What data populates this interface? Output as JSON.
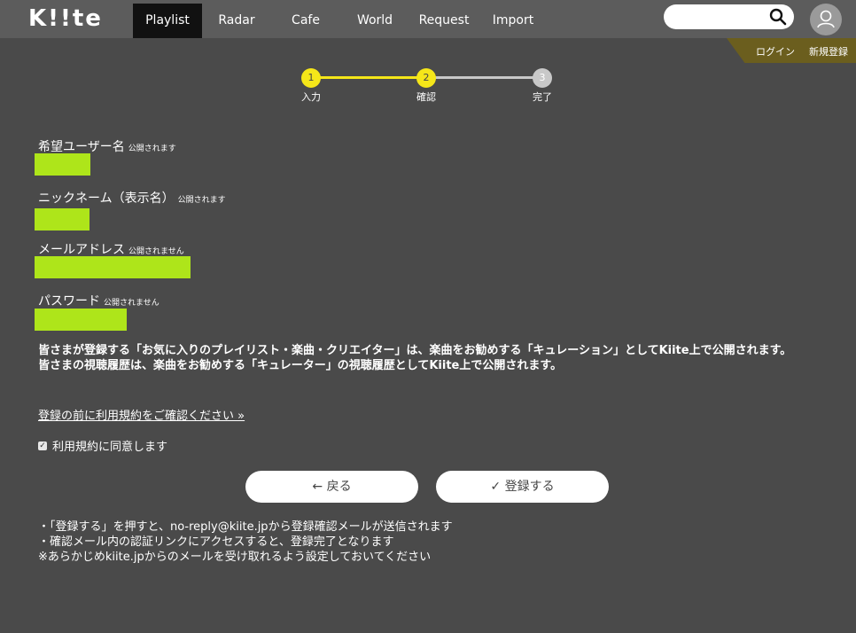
{
  "header": {
    "logo": "K!!te",
    "nav": [
      "Playlist",
      "Radar",
      "Cafe",
      "World",
      "Request",
      "Import"
    ],
    "active_nav": "Playlist",
    "search": {
      "placeholder": ""
    },
    "login": "ログイン",
    "register": "新規登録"
  },
  "steps": [
    {
      "num": "1",
      "label": "入力",
      "state": "done"
    },
    {
      "num": "2",
      "label": "確認",
      "state": "current"
    },
    {
      "num": "3",
      "label": "完了",
      "state": "pending"
    }
  ],
  "fields": [
    {
      "label": "希望ユーザー名",
      "note": "公開されます"
    },
    {
      "label": "ニックネーム（表示名）",
      "note": "公開されます"
    },
    {
      "label": "メールアドレス",
      "note": "公開されません"
    },
    {
      "label": "パスワード",
      "note": "公開されません"
    }
  ],
  "notice": {
    "line1": "皆さまが登録する「お気に入りのプレイリスト・楽曲・クリエイター」は、楽曲をお勧めする「キュレーション」としてKiite上で公開されます。",
    "line2": "皆さまの視聴履歴は、楽曲をお勧めする「キュレーター」の視聴履歴としてKiite上で公開されます。"
  },
  "terms_link": "登録の前に利用規約をご確認ください »",
  "agree_label": "利用規約に同意します",
  "buttons": {
    "back": "戻る",
    "register": "登録する"
  },
  "info": [
    "・「登録する」を押すと、no-reply@kiite.jpから登録確認メールが送信されます",
    "・確認メール内の認証リンクにアクセスすると、登録完了となります",
    "※あらかじめkiite.jpからのメールを受け取れるよう設定しておいてください"
  ],
  "colors": {
    "accent": "#f5e619",
    "highlight": "#aee51a",
    "pending": "#c8c8c8"
  }
}
